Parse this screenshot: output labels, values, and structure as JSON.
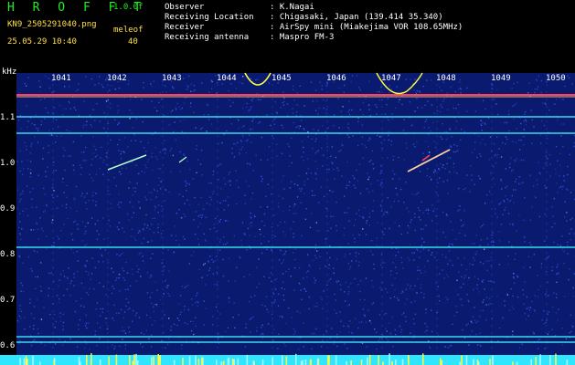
{
  "header": {
    "app_name": "H R O F F T",
    "version": "1.0.0f",
    "filename": "KN9_2505291040.png",
    "mode": "meleof",
    "timestamp": "25.05.29 10:40",
    "count": "40"
  },
  "meta": [
    {
      "key": "Observer",
      "value": ": K.Nagai"
    },
    {
      "key": "Receiving Location",
      "value": ": Chigasaki, Japan (139.414 35.340)"
    },
    {
      "key": "Receiver",
      "value": ": AirSpy mini (Miakejima VOR 108.65MHz)"
    },
    {
      "key": "Receiving antenna",
      "value": ": Maspro FM-3"
    }
  ],
  "axis": {
    "y_unit": "kHz",
    "y_ticks": [
      "1.1",
      "1.0",
      "0.9",
      "0.8",
      "0.7",
      "0.6"
    ],
    "x_ticks": [
      "1041",
      "1042",
      "1043",
      "1044",
      "1045",
      "1046",
      "1047",
      "1048",
      "1049",
      "1050"
    ]
  },
  "colors": {
    "background": "#0a1a6e",
    "noise": "#3a5cff",
    "line_cyan": "#40ffff",
    "band_red": "#ff4060",
    "signal": "#ffff40"
  }
}
